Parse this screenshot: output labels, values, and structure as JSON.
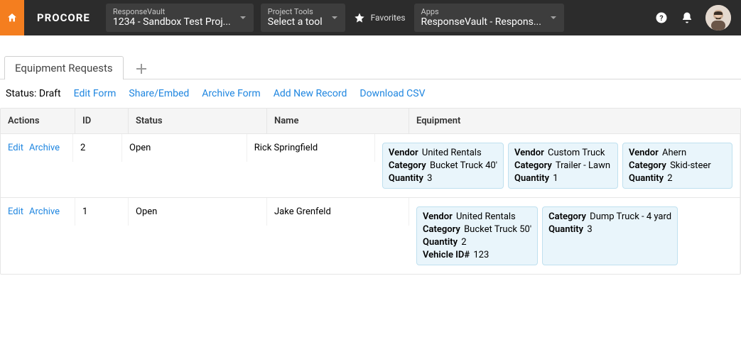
{
  "topbar": {
    "logo": "PROCORE",
    "company_selector": {
      "label": "ResponseVault",
      "value": "1234 - Sandbox Test Proj..."
    },
    "tools_selector": {
      "label": "Project Tools",
      "value": "Select a tool"
    },
    "favorites_label": "Favorites",
    "apps_selector": {
      "label": "Apps",
      "value": "ResponseVault - Respons..."
    }
  },
  "tabs": {
    "active": "Equipment Requests"
  },
  "toolbar": {
    "status_label": "Status:",
    "status_value": "Draft",
    "edit_form": "Edit Form",
    "share": "Share/Embed",
    "archive_form": "Archive Form",
    "add_new": "Add New Record",
    "download_csv": "Download CSV"
  },
  "columns": {
    "actions": "Actions",
    "id": "ID",
    "status": "Status",
    "name": "Name",
    "equipment": "Equipment"
  },
  "row_actions": {
    "edit": "Edit",
    "archive": "Archive"
  },
  "labels": {
    "vendor": "Vendor",
    "category": "Category",
    "quantity": "Quantity",
    "vehicle_id": "Vehicle ID#"
  },
  "rows": [
    {
      "id": "2",
      "status": "Open",
      "name": "Rick Springfield",
      "equipment": [
        {
          "vendor": "United Rentals",
          "category": "Bucket Truck 40'",
          "quantity": "3"
        },
        {
          "vendor": "Custom Truck",
          "category": "Trailer - Lawn",
          "quantity": "1"
        },
        {
          "vendor": "Ahern",
          "category": "Skid-steer",
          "quantity": "2"
        }
      ]
    },
    {
      "id": "1",
      "status": "Open",
      "name": "Jake Grenfeld",
      "equipment": [
        {
          "vendor": "United Rentals",
          "category": "Bucket Truck 50'",
          "quantity": "2",
          "vehicle_id": "123"
        },
        {
          "category": "Dump Truck - 4 yard",
          "quantity": "3"
        }
      ]
    }
  ]
}
